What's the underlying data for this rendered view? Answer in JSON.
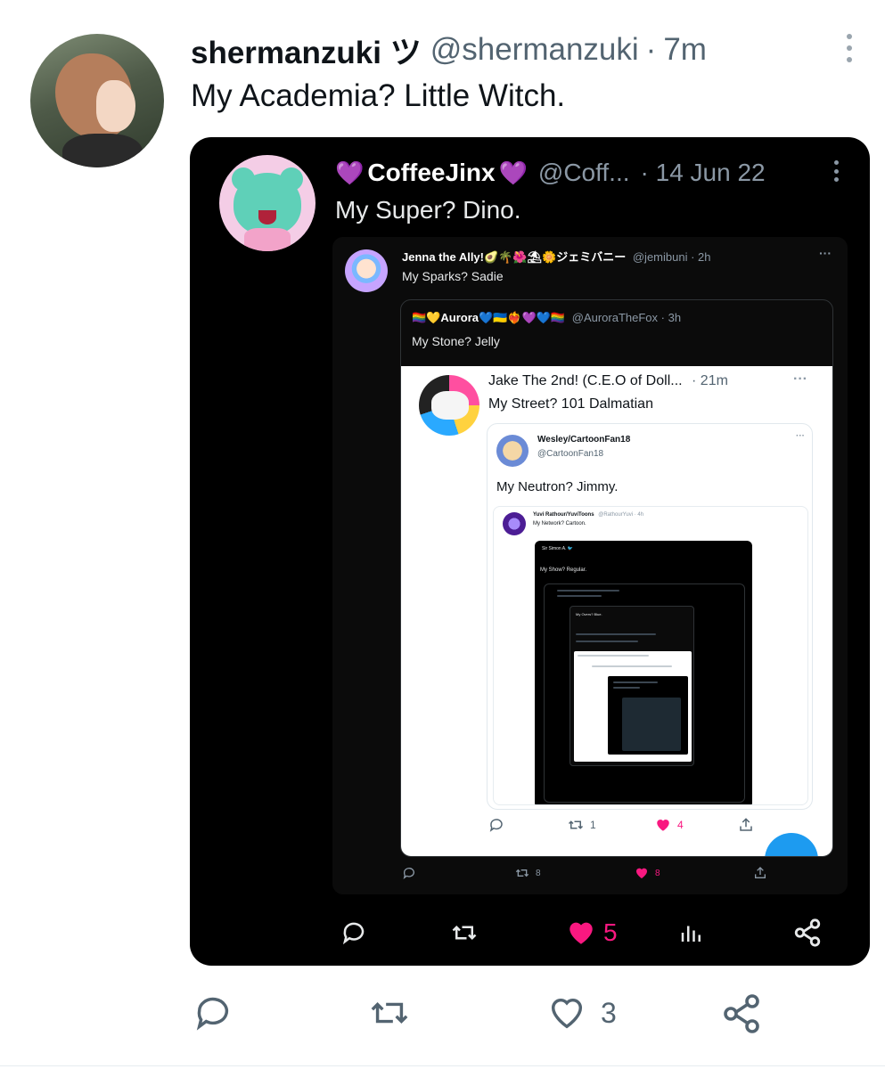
{
  "outer_tweet": {
    "name": "shermanzuki ツ",
    "handle": "@shermanzuki",
    "separator": "·",
    "time": "7m",
    "text": "My Academia? Little Witch.",
    "actions": {
      "like_count": "3"
    }
  },
  "embed": {
    "author": {
      "heart_left": "💜",
      "name": "CoffeeJinx",
      "heart_right": "💜",
      "handle": "@Coff...",
      "time": "· 14 Jun 22",
      "text": "My Super? Dino."
    },
    "jenna": {
      "name": "Jenna the Ally!🥑🌴🌺⛱🌼ジェミバニー",
      "handle": "@jemibuni · 2h",
      "more": "···",
      "text": "My Sparks? Sadie",
      "actions": {
        "retweet_count": "8",
        "like_count": "8"
      }
    },
    "aurora": {
      "name": "🏳️‍🌈💛Aurora💙🇺🇦❤️‍🔥💜💙🏳️‍🌈",
      "handle": "@AuroraTheFox · 3h",
      "text": "My Stone? Jelly"
    },
    "jake": {
      "name": "Jake The 2nd! (C.E.O of Doll...",
      "time": "· 21m",
      "more": "···",
      "text": "My Street? 101 Dalmatian",
      "actions": {
        "retweet_count": "1",
        "like_count": "4"
      }
    },
    "wesley": {
      "name": "Wesley/CartoonFan18",
      "handle": "@CartoonFan18",
      "more": "···",
      "text": "My Neutron? Jimmy."
    },
    "yuvi": {
      "name": "Yuvi Rathour/YuviToons",
      "handle": "@RathourYuvi · 4h",
      "text": "My Network? Cartoon."
    },
    "tiny": {
      "header": "Sir Simon A. 🐦",
      "text": "My Show? Regular.",
      "nested_text": "My Overs? Blue."
    },
    "actions": {
      "like_count": "5"
    }
  },
  "colors": {
    "like_pink": "#f91880",
    "muted": "#536471",
    "brand_blue": "#1d9bf0"
  },
  "icons": [
    "reply-icon",
    "retweet-icon",
    "like-icon",
    "analytics-icon",
    "share-icon",
    "more-icon"
  ]
}
